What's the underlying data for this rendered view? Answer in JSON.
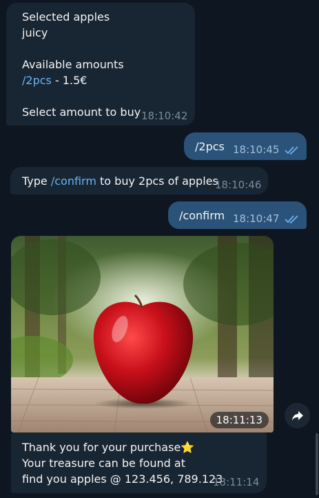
{
  "messages": {
    "m1": {
      "lines": [
        "Selected apples",
        "juicy",
        "Available amounts",
        "/2pcs",
        " - 1.5€",
        "Select amount to buy"
      ],
      "time": "18:10:42"
    },
    "m2": {
      "text": "/2pcs",
      "time": "18:10:45"
    },
    "m3": {
      "pre": "Type ",
      "link": "/confirm",
      "post": " to buy 2pcs of apples",
      "time": "18:10:46"
    },
    "m4": {
      "text": "/confirm",
      "time": "18:10:47"
    },
    "m5": {
      "image_time": "18:11:13",
      "lines": [
        "Thank you for your purchase",
        "Your treasure can be found at",
        "find you apples @ 123.456, 789.123"
      ],
      "emoji": "⭐",
      "time": "18:11:14"
    }
  },
  "icons": {
    "read_status": "double-check-icon",
    "share": "share-arrow-icon"
  },
  "colors": {
    "background": "#0e1621",
    "incoming": "#182533",
    "outgoing": "#2b5278",
    "link": "#6ab3f3"
  }
}
